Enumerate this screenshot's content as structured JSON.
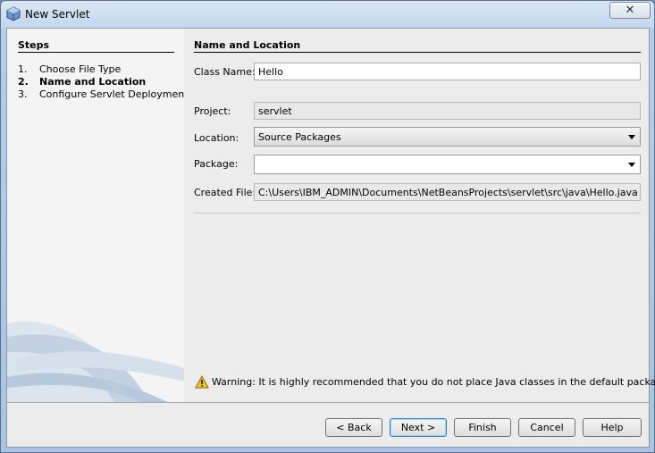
{
  "window": {
    "title": "New Servlet",
    "close_symbol": "✕"
  },
  "steps": {
    "title": "Steps",
    "items": [
      {
        "num": "1.",
        "label": "Choose File Type",
        "active": false
      },
      {
        "num": "2.",
        "label": "Name and Location",
        "active": true
      },
      {
        "num": "3.",
        "label": "Configure Servlet Deployment",
        "active": false
      }
    ]
  },
  "form": {
    "section_title": "Name and Location",
    "class_name_label": "Class Name:",
    "class_name_value": "Hello",
    "project_label": "Project:",
    "project_value": "servlet",
    "location_label": "Location:",
    "location_value": "Source Packages",
    "package_label": "Package:",
    "package_value": "",
    "created_file_label": "Created File:",
    "created_file_value": "C:\\Users\\IBM_ADMIN\\Documents\\NetBeansProjects\\servlet\\src\\java\\Hello.java"
  },
  "warning": {
    "text": "Warning: It is highly recommended that you do not place Java classes in the default package."
  },
  "buttons": {
    "back": "< Back",
    "next": "Next >",
    "finish": "Finish",
    "cancel": "Cancel",
    "help": "Help"
  },
  "icons": {
    "window": "netbeans-cube-icon",
    "warning": "warning-triangle-icon",
    "dropdown": "chevron-down-icon"
  }
}
